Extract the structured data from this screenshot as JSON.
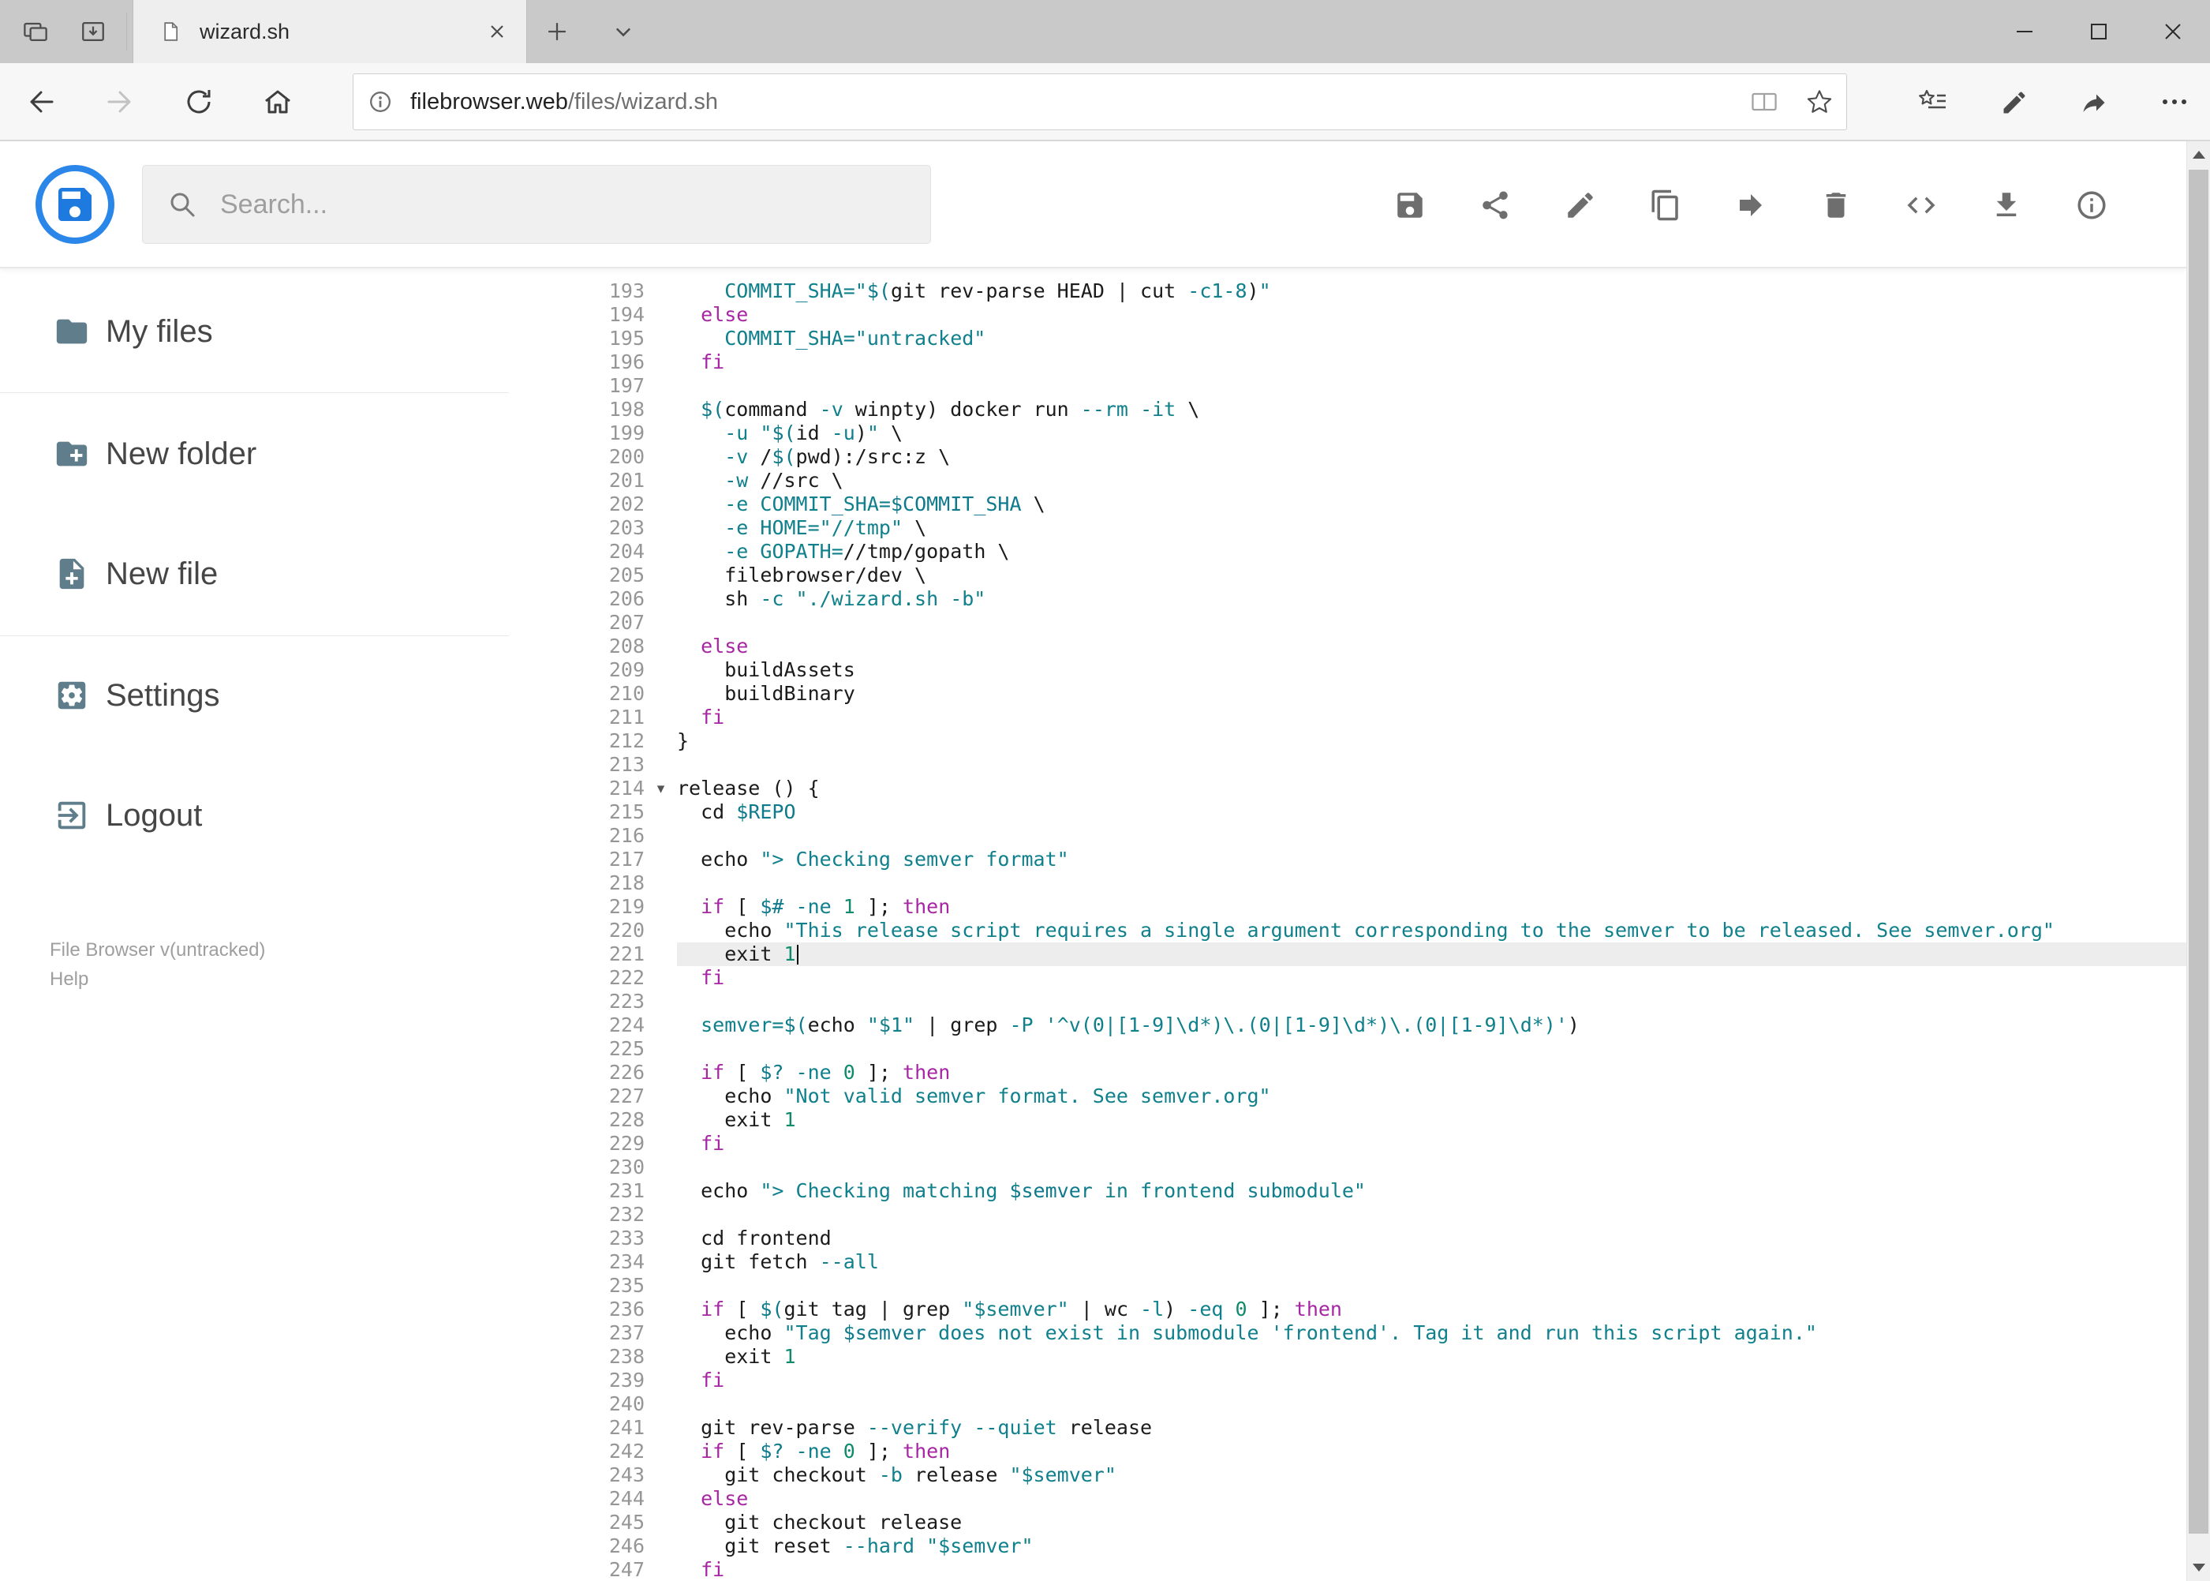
{
  "browser": {
    "tab_title": "wizard.sh",
    "url_host": "filebrowser.web",
    "url_path": "/files/wizard.sh",
    "tab_bar_icons": [
      "tab-preview",
      "set-tabs-aside"
    ],
    "nav_icons": [
      "back",
      "forward",
      "refresh",
      "home"
    ],
    "address_icons": [
      "page-info",
      "reading-view",
      "favorite-star"
    ],
    "right_icons": [
      "favorites-hub",
      "web-note-pen",
      "share",
      "more-options"
    ],
    "window_controls": [
      "minimize",
      "maximize",
      "close"
    ]
  },
  "header": {
    "search_placeholder": "Search...",
    "toolbar_icons": [
      "save",
      "share",
      "edit",
      "copy",
      "move",
      "delete",
      "code",
      "download",
      "info"
    ]
  },
  "sidebar": {
    "items": [
      {
        "label": "My files",
        "icon": "folder-icon"
      },
      {
        "label": "New folder",
        "icon": "new-folder-icon"
      },
      {
        "label": "New file",
        "icon": "new-file-icon"
      },
      {
        "label": "Settings",
        "icon": "settings-icon"
      },
      {
        "label": "Logout",
        "icon": "logout-icon"
      }
    ],
    "footer_version": "File Browser v(untracked)",
    "footer_help": "Help"
  },
  "editor": {
    "language": "shell",
    "first_line": 193,
    "last_line": 247,
    "active_line": 221,
    "fold_marker_line": 214,
    "lines": [
      {
        "n": 193,
        "t": [
          [
            "p",
            "    "
          ],
          [
            "d",
            "COMMIT_SHA="
          ],
          [
            "s",
            "\""
          ],
          [
            "v",
            "$("
          ],
          [
            "p",
            "git rev-parse HEAD | cut "
          ],
          [
            "a",
            "-c1-8"
          ],
          [
            "p",
            ")"
          ],
          [
            "s",
            "\""
          ]
        ]
      },
      {
        "n": 194,
        "t": [
          [
            "p",
            "  "
          ],
          [
            "k",
            "else"
          ]
        ]
      },
      {
        "n": 195,
        "t": [
          [
            "p",
            "    "
          ],
          [
            "d",
            "COMMIT_SHA="
          ],
          [
            "s",
            "\"untracked\""
          ]
        ]
      },
      {
        "n": 196,
        "t": [
          [
            "p",
            "  "
          ],
          [
            "k",
            "fi"
          ]
        ]
      },
      {
        "n": 197,
        "t": []
      },
      {
        "n": 198,
        "t": [
          [
            "p",
            "  "
          ],
          [
            "v",
            "$("
          ],
          [
            "p",
            "command "
          ],
          [
            "a",
            "-v"
          ],
          [
            "p",
            " winpty) docker run "
          ],
          [
            "a",
            "--rm"
          ],
          [
            "p",
            " "
          ],
          [
            "a",
            "-it"
          ],
          [
            "p",
            " \\"
          ]
        ]
      },
      {
        "n": 199,
        "t": [
          [
            "p",
            "    "
          ],
          [
            "a",
            "-u"
          ],
          [
            "p",
            " "
          ],
          [
            "s",
            "\""
          ],
          [
            "v",
            "$("
          ],
          [
            "p",
            "id "
          ],
          [
            "a",
            "-u"
          ],
          [
            "p",
            ")"
          ],
          [
            "s",
            "\""
          ],
          [
            "p",
            " \\"
          ]
        ]
      },
      {
        "n": 200,
        "t": [
          [
            "p",
            "    "
          ],
          [
            "a",
            "-v"
          ],
          [
            "p",
            " /"
          ],
          [
            "v",
            "$("
          ],
          [
            "p",
            "pwd):/src:z \\"
          ]
        ]
      },
      {
        "n": 201,
        "t": [
          [
            "p",
            "    "
          ],
          [
            "a",
            "-w"
          ],
          [
            "p",
            " //src \\"
          ]
        ]
      },
      {
        "n": 202,
        "t": [
          [
            "p",
            "    "
          ],
          [
            "a",
            "-e"
          ],
          [
            "p",
            " "
          ],
          [
            "d",
            "COMMIT_SHA="
          ],
          [
            "v",
            "$COMMIT_SHA"
          ],
          [
            "p",
            " \\"
          ]
        ]
      },
      {
        "n": 203,
        "t": [
          [
            "p",
            "    "
          ],
          [
            "a",
            "-e"
          ],
          [
            "p",
            " "
          ],
          [
            "d",
            "HOME="
          ],
          [
            "s",
            "\"//tmp\""
          ],
          [
            "p",
            " \\"
          ]
        ]
      },
      {
        "n": 204,
        "t": [
          [
            "p",
            "    "
          ],
          [
            "a",
            "-e"
          ],
          [
            "p",
            " "
          ],
          [
            "d",
            "GOPATH="
          ],
          [
            "p",
            "//tmp/gopath \\"
          ]
        ]
      },
      {
        "n": 205,
        "t": [
          [
            "p",
            "    filebrowser/dev \\"
          ]
        ]
      },
      {
        "n": 206,
        "t": [
          [
            "p",
            "    sh "
          ],
          [
            "a",
            "-c"
          ],
          [
            "p",
            " "
          ],
          [
            "s",
            "\"./wizard.sh -b\""
          ]
        ]
      },
      {
        "n": 207,
        "t": []
      },
      {
        "n": 208,
        "t": [
          [
            "p",
            "  "
          ],
          [
            "k",
            "else"
          ]
        ]
      },
      {
        "n": 209,
        "t": [
          [
            "p",
            "    buildAssets"
          ]
        ]
      },
      {
        "n": 210,
        "t": [
          [
            "p",
            "    buildBinary"
          ]
        ]
      },
      {
        "n": 211,
        "t": [
          [
            "p",
            "  "
          ],
          [
            "k",
            "fi"
          ]
        ]
      },
      {
        "n": 212,
        "t": [
          [
            "p",
            "}"
          ]
        ]
      },
      {
        "n": 213,
        "t": []
      },
      {
        "n": 214,
        "t": [
          [
            "p",
            "release () {"
          ]
        ]
      },
      {
        "n": 215,
        "t": [
          [
            "p",
            "  cd "
          ],
          [
            "v",
            "$REPO"
          ]
        ]
      },
      {
        "n": 216,
        "t": []
      },
      {
        "n": 217,
        "t": [
          [
            "p",
            "  echo "
          ],
          [
            "s",
            "\"> Checking semver format\""
          ]
        ]
      },
      {
        "n": 218,
        "t": []
      },
      {
        "n": 219,
        "t": [
          [
            "p",
            "  "
          ],
          [
            "k",
            "if"
          ],
          [
            "p",
            " [ "
          ],
          [
            "v",
            "$#"
          ],
          [
            "p",
            " "
          ],
          [
            "a",
            "-ne"
          ],
          [
            "p",
            " "
          ],
          [
            "n",
            "1"
          ],
          [
            "p",
            " ]; "
          ],
          [
            "k",
            "then"
          ]
        ]
      },
      {
        "n": 220,
        "t": [
          [
            "p",
            "    echo "
          ],
          [
            "s",
            "\"This release script requires a single argument corresponding to the semver to be released. See semver.org\""
          ]
        ]
      },
      {
        "n": 221,
        "t": [
          [
            "p",
            "    exit "
          ],
          [
            "n",
            "1"
          ]
        ]
      },
      {
        "n": 222,
        "t": [
          [
            "p",
            "  "
          ],
          [
            "k",
            "fi"
          ]
        ]
      },
      {
        "n": 223,
        "t": []
      },
      {
        "n": 224,
        "t": [
          [
            "p",
            "  "
          ],
          [
            "d",
            "semver="
          ],
          [
            "v",
            "$("
          ],
          [
            "p",
            "echo "
          ],
          [
            "s",
            "\"$1\""
          ],
          [
            "p",
            " | grep "
          ],
          [
            "a",
            "-P"
          ],
          [
            "p",
            " "
          ],
          [
            "s",
            "'^v(0|[1-9]\\d*)\\.(0|[1-9]\\d*)\\.(0|[1-9]\\d*)'"
          ],
          [
            "p",
            ")"
          ]
        ]
      },
      {
        "n": 225,
        "t": []
      },
      {
        "n": 226,
        "t": [
          [
            "p",
            "  "
          ],
          [
            "k",
            "if"
          ],
          [
            "p",
            " [ "
          ],
          [
            "v",
            "$?"
          ],
          [
            "p",
            " "
          ],
          [
            "a",
            "-ne"
          ],
          [
            "p",
            " "
          ],
          [
            "n",
            "0"
          ],
          [
            "p",
            " ]; "
          ],
          [
            "k",
            "then"
          ]
        ]
      },
      {
        "n": 227,
        "t": [
          [
            "p",
            "    echo "
          ],
          [
            "s",
            "\"Not valid semver format. See semver.org\""
          ]
        ]
      },
      {
        "n": 228,
        "t": [
          [
            "p",
            "    exit "
          ],
          [
            "n",
            "1"
          ]
        ]
      },
      {
        "n": 229,
        "t": [
          [
            "p",
            "  "
          ],
          [
            "k",
            "fi"
          ]
        ]
      },
      {
        "n": 230,
        "t": []
      },
      {
        "n": 231,
        "t": [
          [
            "p",
            "  echo "
          ],
          [
            "s",
            "\"> Checking matching "
          ],
          [
            "v",
            "$semver"
          ],
          [
            "s",
            " in frontend submodule\""
          ]
        ]
      },
      {
        "n": 232,
        "t": []
      },
      {
        "n": 233,
        "t": [
          [
            "p",
            "  cd frontend"
          ]
        ]
      },
      {
        "n": 234,
        "t": [
          [
            "p",
            "  git fetch "
          ],
          [
            "a",
            "--all"
          ]
        ]
      },
      {
        "n": 235,
        "t": []
      },
      {
        "n": 236,
        "t": [
          [
            "p",
            "  "
          ],
          [
            "k",
            "if"
          ],
          [
            "p",
            " [ "
          ],
          [
            "v",
            "$("
          ],
          [
            "p",
            "git tag | grep "
          ],
          [
            "s",
            "\"$semver\""
          ],
          [
            "p",
            " | wc "
          ],
          [
            "a",
            "-l"
          ],
          [
            "p",
            ") "
          ],
          [
            "a",
            "-eq"
          ],
          [
            "p",
            " "
          ],
          [
            "n",
            "0"
          ],
          [
            "p",
            " ]; "
          ],
          [
            "k",
            "then"
          ]
        ]
      },
      {
        "n": 237,
        "t": [
          [
            "p",
            "    echo "
          ],
          [
            "s",
            "\"Tag "
          ],
          [
            "v",
            "$semver"
          ],
          [
            "s",
            " does not exist in submodule 'frontend'. Tag it and run this script again.\""
          ]
        ]
      },
      {
        "n": 238,
        "t": [
          [
            "p",
            "    exit "
          ],
          [
            "n",
            "1"
          ]
        ]
      },
      {
        "n": 239,
        "t": [
          [
            "p",
            "  "
          ],
          [
            "k",
            "fi"
          ]
        ]
      },
      {
        "n": 240,
        "t": []
      },
      {
        "n": 241,
        "t": [
          [
            "p",
            "  git rev-parse "
          ],
          [
            "a",
            "--verify"
          ],
          [
            "p",
            " "
          ],
          [
            "a",
            "--quiet"
          ],
          [
            "p",
            " release"
          ]
        ]
      },
      {
        "n": 242,
        "t": [
          [
            "p",
            "  "
          ],
          [
            "k",
            "if"
          ],
          [
            "p",
            " [ "
          ],
          [
            "v",
            "$?"
          ],
          [
            "p",
            " "
          ],
          [
            "a",
            "-ne"
          ],
          [
            "p",
            " "
          ],
          [
            "n",
            "0"
          ],
          [
            "p",
            " ]; "
          ],
          [
            "k",
            "then"
          ]
        ]
      },
      {
        "n": 243,
        "t": [
          [
            "p",
            "    git checkout "
          ],
          [
            "a",
            "-b"
          ],
          [
            "p",
            " release "
          ],
          [
            "s",
            "\"$semver\""
          ]
        ]
      },
      {
        "n": 244,
        "t": [
          [
            "p",
            "  "
          ],
          [
            "k",
            "else"
          ]
        ]
      },
      {
        "n": 245,
        "t": [
          [
            "p",
            "    git checkout release"
          ]
        ]
      },
      {
        "n": 246,
        "t": [
          [
            "p",
            "    git reset "
          ],
          [
            "a",
            "--hard"
          ],
          [
            "p",
            " "
          ],
          [
            "s",
            "\"$semver\""
          ]
        ]
      },
      {
        "n": 247,
        "t": [
          [
            "p",
            "  "
          ],
          [
            "k",
            "fi"
          ]
        ]
      }
    ]
  },
  "colors": {
    "accent_blue": "#2a86e8",
    "keyword": "#a626a4",
    "string": "#10808c",
    "variable": "#0e7a8c",
    "attribute": "#10808c",
    "number": "#0f8a6d",
    "active_line_bg": "#ededed",
    "line_number": "#969696"
  }
}
